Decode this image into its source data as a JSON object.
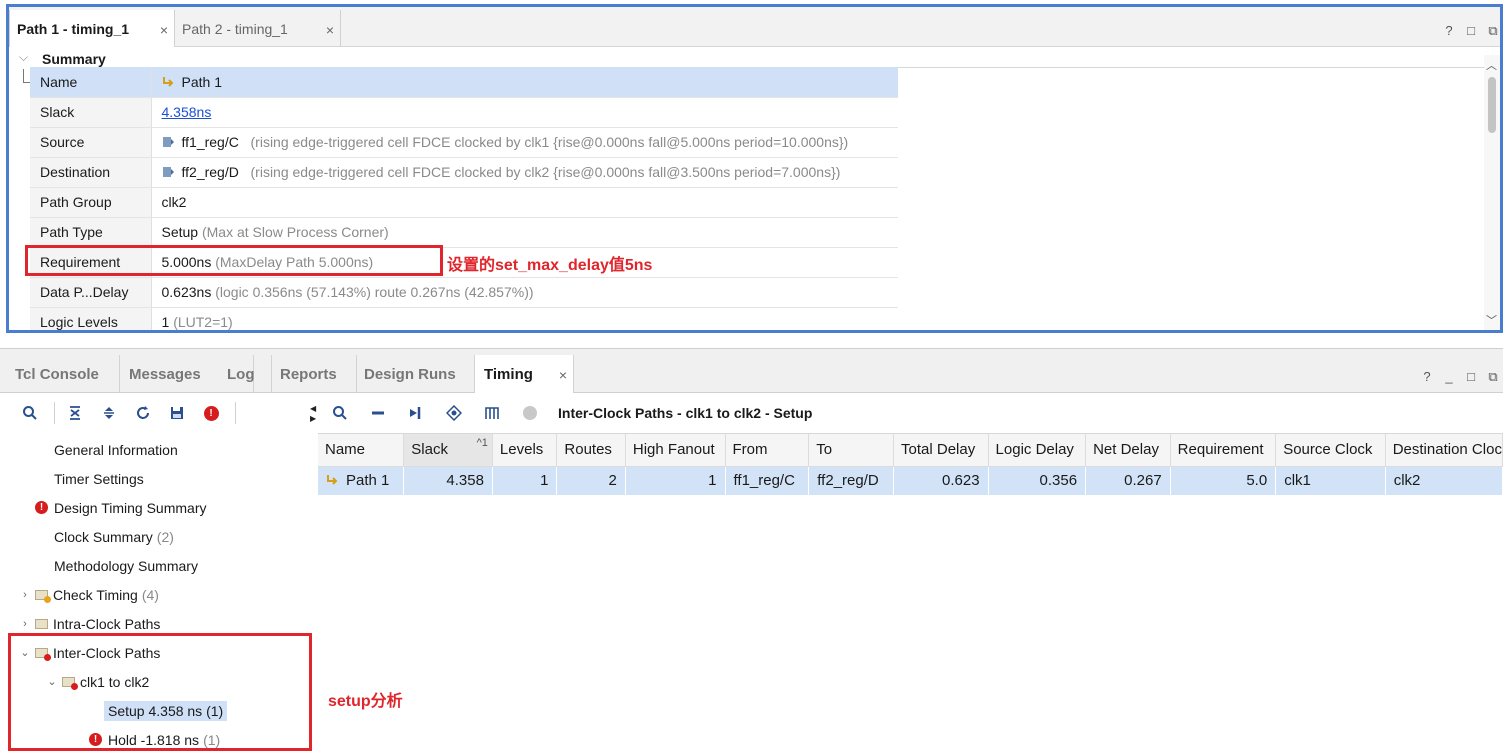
{
  "top_panel": {
    "tabs": [
      {
        "label": "Path 1 - timing_1",
        "close": "×"
      },
      {
        "label": "Path 2 - timing_1",
        "close": "×"
      }
    ],
    "window_controls": [
      "?",
      "□",
      "⧉"
    ],
    "summary_heading": "Summary",
    "rows": [
      {
        "key": "Name",
        "value": "Path 1",
        "extra": ""
      },
      {
        "key": "Slack",
        "value": "4.358ns",
        "extra": ""
      },
      {
        "key": "Source",
        "value": "ff1_reg/C",
        "extra": "(rising edge-triggered cell FDCE clocked by clk1  {rise@0.000ns fall@5.000ns period=10.000ns})"
      },
      {
        "key": "Destination",
        "value": "ff2_reg/D",
        "extra": "(rising edge-triggered cell FDCE clocked by clk2  {rise@0.000ns fall@3.500ns period=7.000ns})"
      },
      {
        "key": "Path Group",
        "value": "clk2",
        "extra": ""
      },
      {
        "key": "Path Type",
        "value": "Setup",
        "extra": "(Max at Slow Process Corner)"
      },
      {
        "key": "Requirement",
        "value": "5.000ns",
        "extra": "(MaxDelay Path 5.000ns)"
      },
      {
        "key": "Data P...Delay",
        "value": "0.623ns",
        "extra": "(logic 0.356ns (57.143%)  route 0.267ns (42.857%))"
      },
      {
        "key": "Logic Levels",
        "value": "1",
        "extra": "(LUT2=1)"
      }
    ],
    "annotation": "设置的set_max_delay值5ns"
  },
  "bottom_panel": {
    "tabs": [
      "Tcl Console",
      "Messages",
      "Log",
      "Reports",
      "Design Runs",
      "Timing"
    ],
    "active_tab_close": "×",
    "window_controls": [
      "?",
      "_",
      "□",
      "⧉"
    ],
    "toolbar_title": "Inter-Clock Paths - clk1 to clk2 - Setup",
    "nav": {
      "general_information": "General Information",
      "timer_settings": "Timer Settings",
      "design_timing_summary": "Design Timing Summary",
      "clock_summary": "Clock Summary",
      "clock_summary_count": "(2)",
      "methodology_summary": "Methodology Summary",
      "check_timing": "Check Timing",
      "check_timing_count": "(4)",
      "intra_clock_paths": "Intra-Clock Paths",
      "inter_clock_paths": "Inter-Clock Paths",
      "clk1_to_clk2": "clk1 to clk2",
      "setup": "Setup 4.358 ns (1)",
      "hold": "Hold -1.818 ns",
      "hold_count": "(1)"
    },
    "grid": {
      "columns": [
        "Name",
        "Slack",
        "Levels",
        "Routes",
        "High Fanout",
        "From",
        "To",
        "Total Delay",
        "Logic Delay",
        "Net Delay",
        "Requirement",
        "Source Clock",
        "Destination Cloc"
      ],
      "sort_indicator": "^1",
      "rows": [
        [
          "Path 1",
          "4.358",
          "1",
          "2",
          "1",
          "ff1_reg/C",
          "ff2_reg/D",
          "0.623",
          "0.356",
          "0.267",
          "5.0",
          "clk1",
          "clk2"
        ]
      ]
    },
    "annotation": "setup分析"
  },
  "colors": {
    "highlight": "#cfe0f7",
    "annotation_red": "#e0262c",
    "panel_border_blue": "#4a7dd0",
    "link_blue": "#1a4fd6",
    "error_red": "#d61c1c"
  }
}
